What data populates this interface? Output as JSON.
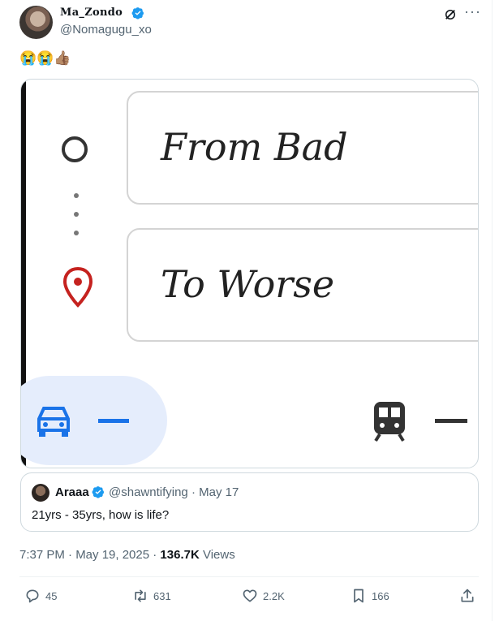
{
  "author": {
    "display_name": "Ma_Zondo",
    "handle": "@Nomagugu_xo"
  },
  "tweet": {
    "text": "😭😭👍🏽",
    "media": {
      "from_label": "From Bad",
      "to_label": "To Worse"
    }
  },
  "quoted_tweet": {
    "name": "Araaa",
    "handle_date": "@shawntifying · May 17",
    "text": "21yrs - 35yrs, how is life?"
  },
  "meta": {
    "timestamp": "7:37 PM · May 19, 2025 · ",
    "views_count": "136.7K",
    "views_label": " Views"
  },
  "actions": {
    "replies": "45",
    "reposts": "631",
    "likes": "2.2K",
    "bookmarks": "166"
  },
  "colors": {
    "verified": "#1d9bf0",
    "car": "#1a73e8",
    "pin": "#c5221f"
  }
}
